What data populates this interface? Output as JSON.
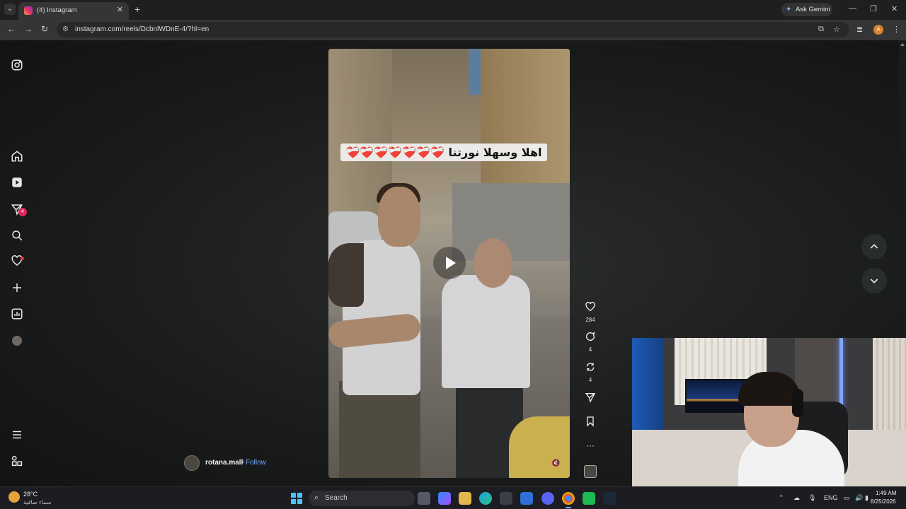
{
  "browser": {
    "tab_title": "(4) Instagram",
    "new_tab_symbol": "+",
    "tab_close_symbol": "✕",
    "url": "instagram.com/reels/DcbnlWDnE-4/?hl=en",
    "gemini_label": "Ask Gemini",
    "profile_initial": "A"
  },
  "sidebar": {
    "notifications_badge": "4",
    "items": [
      "instagram-logo",
      "home",
      "reels",
      "messages",
      "search",
      "notifications",
      "create",
      "dashboard",
      "profile",
      "more",
      "meta-apps"
    ]
  },
  "reel": {
    "caption": "اهلا وسهلا نورتنا ❤️‍🩹❤️‍🩹❤️‍🩹❤️‍🩹❤️‍🩹❤️‍🩹❤️‍🩹",
    "author": "rotana.mall",
    "separator": "•",
    "follow_label": "Follow"
  },
  "actions": {
    "likes": "284",
    "comments": "4",
    "reposts": "4"
  },
  "taskbar": {
    "temperature": "28°C",
    "weather_desc": "سماء صافية",
    "search_label": "Search",
    "language": "ENG",
    "time": "1:49 AM",
    "date": "8/25/2026"
  },
  "colors": {
    "accent_link": "#6fa8ff",
    "badge": "#e0245e",
    "windows_blue": "#4cc2ff"
  }
}
